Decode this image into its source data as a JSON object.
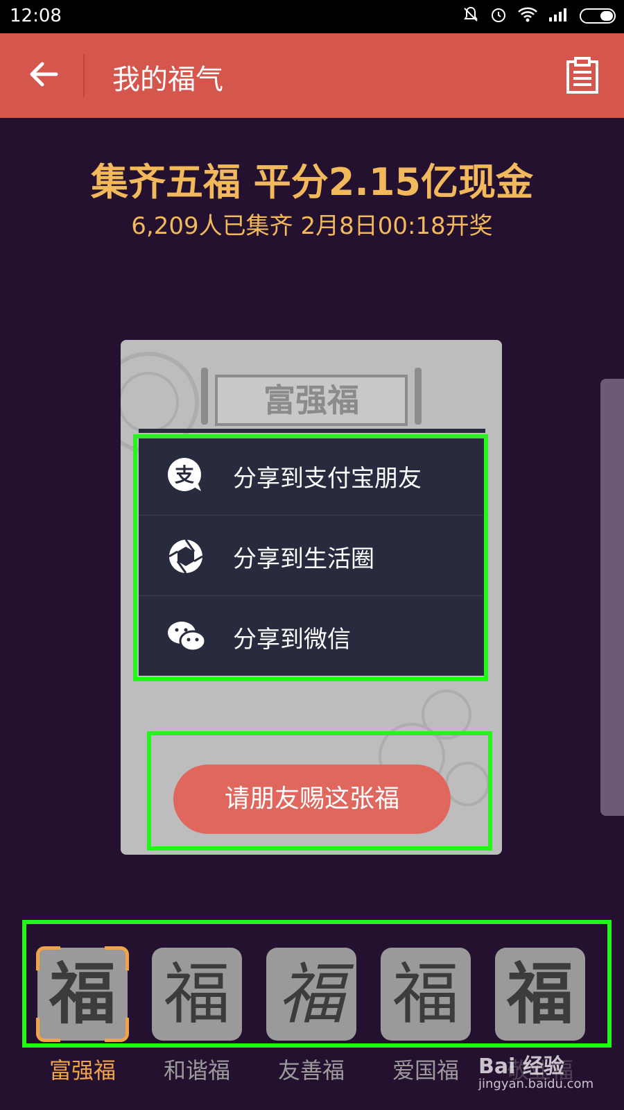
{
  "status_bar": {
    "time": "12:08",
    "icons": [
      "bell-mute-icon",
      "alarm-icon",
      "wifi-icon",
      "signal-icon",
      "battery-icon"
    ]
  },
  "header": {
    "title": "我的福气",
    "back_icon": "arrow-left-icon",
    "records_icon": "clipboard-icon",
    "background": "#d5564c"
  },
  "promo": {
    "headline": "集齐五福 平分2.15亿现金",
    "subline": "6,209人已集齐 2月8日00:18开奖",
    "accent": "#f1b95c"
  },
  "card": {
    "title": "富强福"
  },
  "share_menu": {
    "items": [
      {
        "label": "分享到支付宝朋友",
        "icon": "alipay-icon"
      },
      {
        "label": "分享到生活圈",
        "icon": "aperture-icon"
      },
      {
        "label": "分享到微信",
        "icon": "wechat-icon"
      }
    ]
  },
  "cta": {
    "label": "请朋友赐这张福",
    "color": "#e0675d"
  },
  "fu_tabs": [
    {
      "glyph": "福",
      "label": "富强福",
      "selected": true
    },
    {
      "glyph": "福",
      "label": "和谐福",
      "selected": false
    },
    {
      "glyph": "福",
      "label": "友善福",
      "selected": false
    },
    {
      "glyph": "福",
      "label": "爱国福",
      "selected": false
    },
    {
      "glyph": "福",
      "label": "敬业福",
      "selected": false
    }
  ],
  "watermark": {
    "text": "Bai 经验",
    "url": "jingyan.baidu.com"
  },
  "highlight_color": "#25f51b"
}
